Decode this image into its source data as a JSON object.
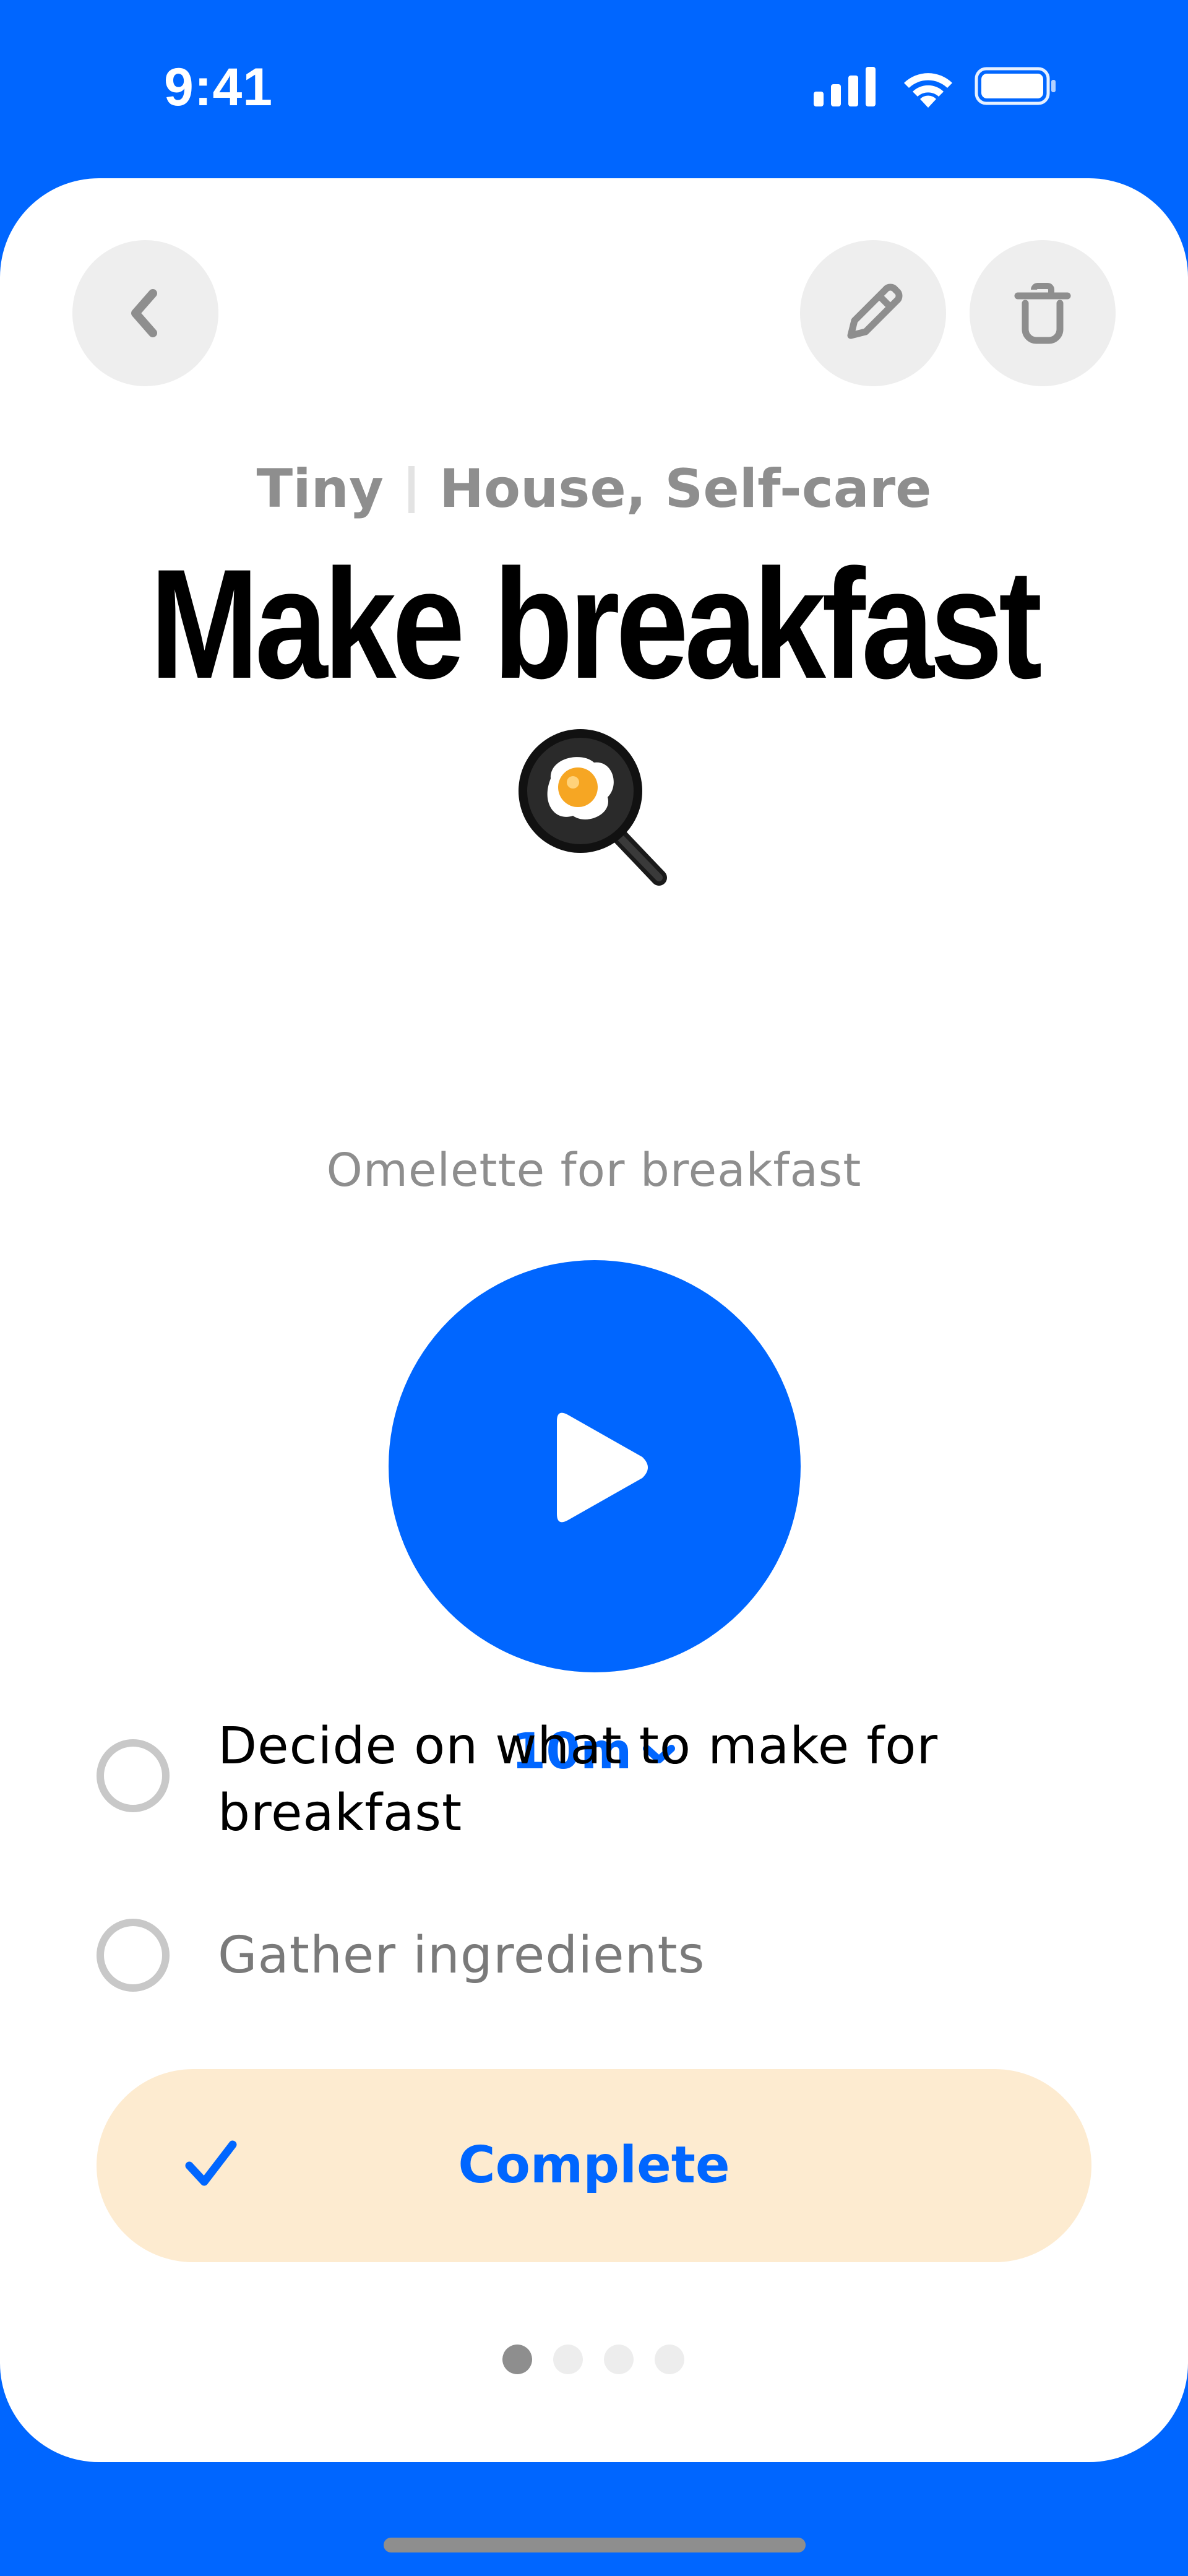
{
  "status_bar": {
    "time": "9:41"
  },
  "task": {
    "size": "Tiny",
    "categories": "House, Self-care",
    "title": "Make breakfast",
    "emoji": "frying-pan-egg",
    "note": "Omelette for breakfast",
    "duration": "10m"
  },
  "subtasks": [
    {
      "label": "Decide on what to make for breakfast",
      "done": false
    },
    {
      "label": "Gather ingredients",
      "done": false
    }
  ],
  "complete_button": {
    "label": "Complete"
  },
  "pagination": {
    "total": 4,
    "current": 1
  },
  "colors": {
    "primary": "#0066FF",
    "button_bg": "#EEEEEE",
    "complete_bg": "#FDEBD0",
    "muted_text": "#8E8E8E"
  },
  "icons": {
    "back": "chevron-left-icon",
    "edit": "pencil-icon",
    "delete": "trash-icon",
    "play": "play-icon",
    "duration": "chevron-down-icon",
    "complete": "checkmark-icon"
  }
}
